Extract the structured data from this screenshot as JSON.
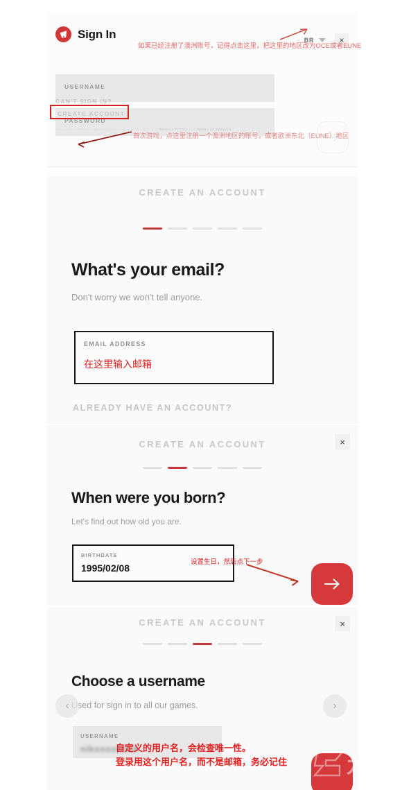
{
  "signin": {
    "title": "Sign In",
    "logo_icon": "riot-logo-icon",
    "region_value": "BR",
    "close_label": "×",
    "username_label": "USERNAME",
    "password_label": "PASSWORD",
    "cant_sign_in": "CAN'T SIGN IN?",
    "create_account": "CREATE ACCOUNT",
    "fineprint_prefix": "THIS SITE IS PROTECTED BY RECAPTCHA AND THE GOOGLE ",
    "fineprint_privacy": "PRIVACY POLICY",
    "fineprint_and": " AND ",
    "fineprint_terms": "TERMS OF SERVICE",
    "fineprint_suffix": "."
  },
  "annotations": {
    "region": "如果已经注册了澳洲账号，记得点击这里，把这里的地区改为OCE或者EUNE",
    "create_account": "首次游戏，点这里注册一个澳洲地区的账号，或者欧洲东北（EUNE）地区",
    "email": "在这里输入邮箱",
    "birthdate": "设置生日，然后点下一步",
    "username_line1": "自定义的用户名，会检查唯一性。",
    "username_line2": "登录用这个用户名，而不是邮箱，务必记住"
  },
  "create_account": {
    "header": "CREATE AN ACCOUNT",
    "close_label": "×",
    "total_steps": 5,
    "steps": [
      {
        "index": 1,
        "active_step": 1,
        "heading": "What's your email?",
        "subtitle": "Don't worry we won't tell anyone.",
        "field_label": "EMAIL ADDRESS",
        "field_value": "在这里输入邮箱",
        "footer_link": "ALREADY HAVE AN ACCOUNT?"
      },
      {
        "index": 2,
        "active_step": 2,
        "heading": "When were you born?",
        "subtitle": "Let's find out how old you are.",
        "field_label": "BIRTHDATE",
        "field_value": "1995/02/08"
      },
      {
        "index": 3,
        "active_step": 3,
        "heading": "Choose a username",
        "subtitle": "Used for sign in to all our games.",
        "field_label": "USERNAME",
        "field_value": "nikoooo2218"
      }
    ]
  },
  "carousel": {
    "prev_icon": "chevron-left-icon",
    "prev_label": "‹",
    "next_icon": "chevron-right-icon",
    "next_label": "›"
  },
  "watermark": {
    "text": "九游"
  },
  "colors": {
    "accent_red": "#d6393c",
    "annotation_red": "#e52222",
    "panel_bg": "#fbfafa",
    "field_bg": "#e9e8e8",
    "muted_text": "#c9c8ca"
  }
}
